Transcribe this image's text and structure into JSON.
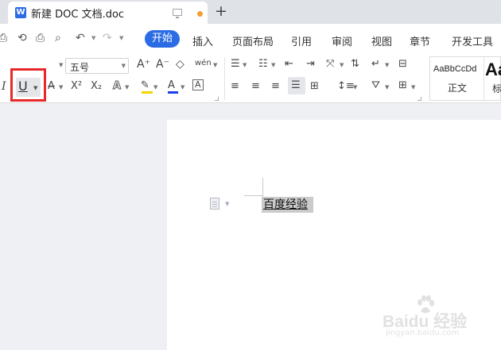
{
  "window": {
    "tab_title": "新建 DOC 文档.doc",
    "doc_icon_glyph": "W",
    "new_tab_glyph": "+"
  },
  "menu": {
    "tabs": [
      "开始",
      "插入",
      "页面布局",
      "引用",
      "审阅",
      "视图",
      "章节",
      "开发工具"
    ],
    "active_tab": "开始"
  },
  "quick_access": {
    "icons": [
      "save-icon",
      "format-painter-icon",
      "print-icon",
      "print-preview-icon",
      "undo-icon",
      "redo-icon"
    ]
  },
  "ribbon": {
    "font_size": "五号",
    "grow_font": "A⁺",
    "shrink_font": "A⁻",
    "pinyin_guide": "wén",
    "italic": "I",
    "underline": "U",
    "strikethrough": "A",
    "superscript": "X²",
    "subscript": "X₂",
    "text_effects": "A",
    "highlight": "✎",
    "font_color": "A",
    "char_border": "A",
    "colors": {
      "highlight": "#f5d400",
      "font_color": "#1a3ee8",
      "selection_frame": "#e8282b",
      "accent": "#2b6ce4"
    },
    "styles": {
      "normal_sample": "AaBbCcDd",
      "normal_name": "正文",
      "heading_sample": "Aa",
      "heading_name": "标"
    }
  },
  "document": {
    "selected_text": "百度经验"
  },
  "watermark": {
    "brand": "Baidu 经验",
    "url": "jingyan.baidu.com"
  }
}
